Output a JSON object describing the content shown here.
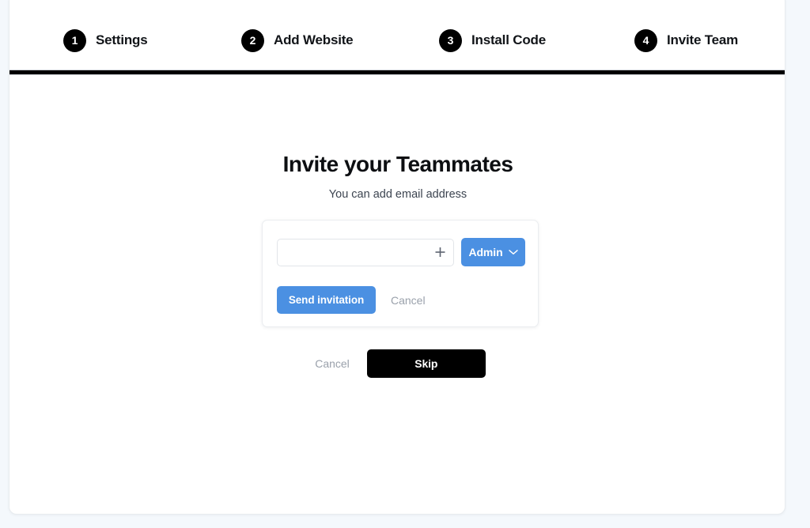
{
  "theme": {
    "page_background": "#f4f8fc",
    "card_background": "#ffffff",
    "accent_blue": "#4b90e2",
    "primary_black": "#000000",
    "muted_text": "#9aa1ab",
    "subtitle_text": "#3c4450"
  },
  "stepper": {
    "steps": [
      {
        "number": "1",
        "label": "Settings"
      },
      {
        "number": "2",
        "label": "Add Website"
      },
      {
        "number": "3",
        "label": "Install Code"
      },
      {
        "number": "4",
        "label": "Invite Team"
      }
    ]
  },
  "main": {
    "title": "Invite your Teammates",
    "subtitle": "You can add email address"
  },
  "invite_box": {
    "email_input": {
      "value": "",
      "placeholder": ""
    },
    "add_icon": "plus-icon",
    "role_dropdown": {
      "selected": "Admin",
      "chevron": "chevron-down-icon",
      "options": [
        "Admin"
      ]
    },
    "send_label": "Send invitation",
    "cancel_label": "Cancel"
  },
  "footer": {
    "cancel_label": "Cancel",
    "skip_label": "Skip"
  }
}
